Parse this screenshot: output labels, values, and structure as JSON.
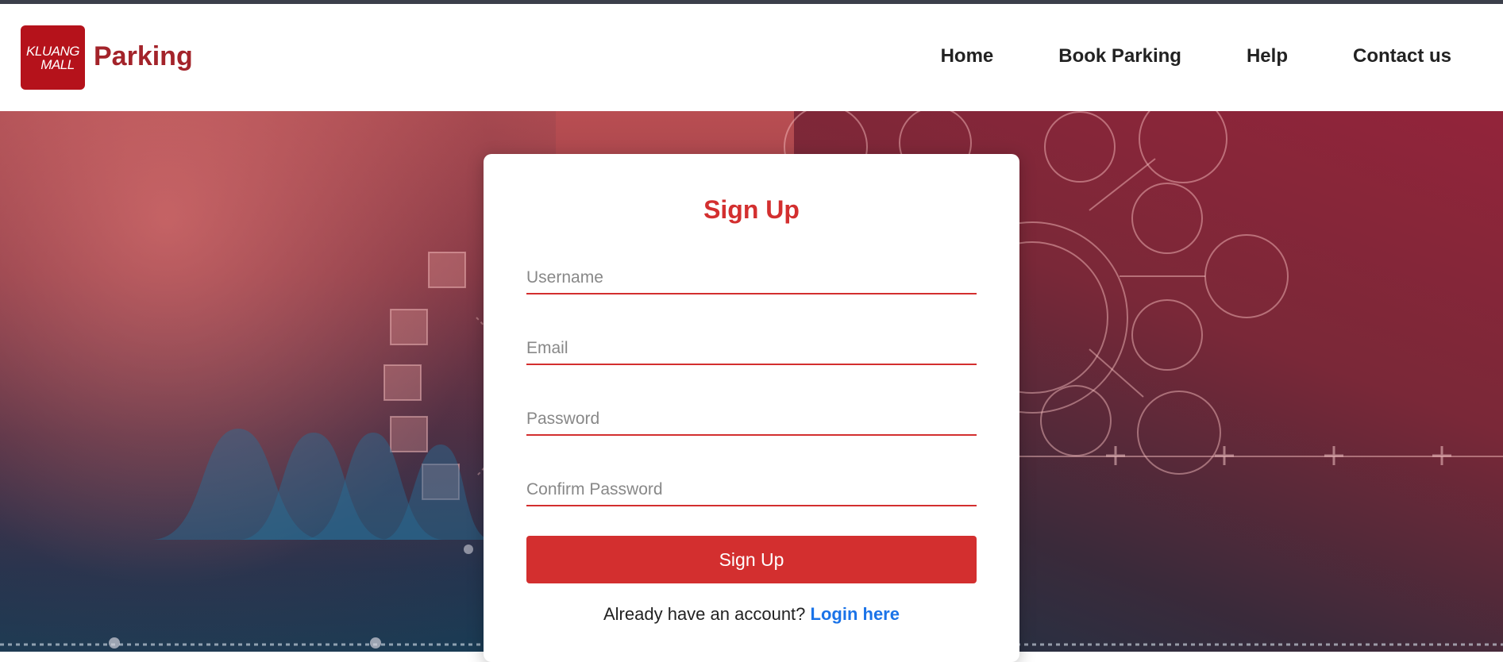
{
  "header": {
    "logo_line1": "KLUANG",
    "logo_line2": "MALL",
    "brand": "Parking",
    "nav": [
      {
        "label": "Home"
      },
      {
        "label": "Book Parking"
      },
      {
        "label": "Help"
      },
      {
        "label": "Contact us"
      }
    ]
  },
  "form": {
    "title": "Sign Up",
    "username_placeholder": "Username",
    "email_placeholder": "Email",
    "password_placeholder": "Password",
    "confirm_placeholder": "Confirm Password",
    "submit_label": "Sign Up",
    "footer_prompt": "Already have an account?",
    "login_link": "Login here"
  },
  "colors": {
    "brand_red": "#a3232a",
    "accent_red": "#d32f2f",
    "link_blue": "#1a73e8"
  }
}
